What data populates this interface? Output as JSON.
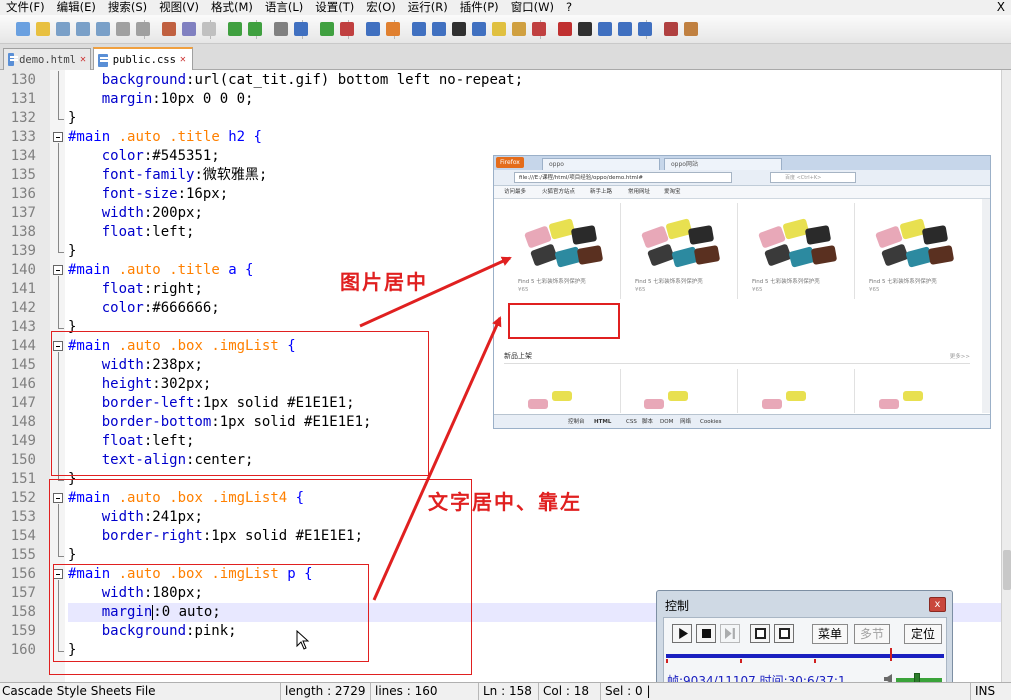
{
  "menubar": {
    "items": [
      "文件(F)",
      "编辑(E)",
      "搜索(S)",
      "视图(V)",
      "格式(M)",
      "语言(L)",
      "设置(T)",
      "宏(O)",
      "运行(R)",
      "插件(P)",
      "窗口(W)",
      "?"
    ],
    "close": "X"
  },
  "tabs": [
    {
      "label": "demo.html"
    },
    {
      "label": "public.css"
    }
  ],
  "editor": {
    "lines": [
      {
        "n": "130",
        "parts": [
          [
            "    ",
            "val"
          ],
          [
            "background",
            "prop"
          ],
          [
            ":url(cat_tit.gif) bottom left no-repeat;",
            "val"
          ]
        ]
      },
      {
        "n": "131",
        "parts": [
          [
            "    ",
            "val"
          ],
          [
            "margin",
            "prop"
          ],
          [
            ":10px 0 0 0;",
            "val"
          ]
        ]
      },
      {
        "n": "132",
        "parts": [
          [
            "}",
            "val"
          ]
        ]
      },
      {
        "n": "133",
        "parts": [
          [
            "#main",
            "id"
          ],
          [
            " ",
            "val"
          ],
          [
            ".auto",
            "cls"
          ],
          [
            " ",
            "val"
          ],
          [
            ".title",
            "cls"
          ],
          [
            " h2 {",
            "sel"
          ]
        ]
      },
      {
        "n": "134",
        "parts": [
          [
            "    ",
            "val"
          ],
          [
            "color",
            "prop"
          ],
          [
            ":#545351;",
            "val"
          ]
        ]
      },
      {
        "n": "135",
        "parts": [
          [
            "    ",
            "val"
          ],
          [
            "font-family",
            "prop"
          ],
          [
            ":微软雅黑;",
            "val"
          ]
        ]
      },
      {
        "n": "136",
        "parts": [
          [
            "    ",
            "val"
          ],
          [
            "font-size",
            "prop"
          ],
          [
            ":16px;",
            "val"
          ]
        ]
      },
      {
        "n": "137",
        "parts": [
          [
            "    ",
            "val"
          ],
          [
            "width",
            "prop"
          ],
          [
            ":200px;",
            "val"
          ]
        ]
      },
      {
        "n": "138",
        "parts": [
          [
            "    ",
            "val"
          ],
          [
            "float",
            "prop"
          ],
          [
            ":left;",
            "val"
          ]
        ]
      },
      {
        "n": "139",
        "parts": [
          [
            "}",
            "val"
          ]
        ]
      },
      {
        "n": "140",
        "parts": [
          [
            "#main",
            "id"
          ],
          [
            " ",
            "val"
          ],
          [
            ".auto",
            "cls"
          ],
          [
            " ",
            "val"
          ],
          [
            ".title",
            "cls"
          ],
          [
            " a {",
            "sel"
          ]
        ]
      },
      {
        "n": "141",
        "parts": [
          [
            "    ",
            "val"
          ],
          [
            "float",
            "prop"
          ],
          [
            ":right;",
            "val"
          ]
        ]
      },
      {
        "n": "142",
        "parts": [
          [
            "    ",
            "val"
          ],
          [
            "color",
            "prop"
          ],
          [
            ":#666666;",
            "val"
          ]
        ]
      },
      {
        "n": "143",
        "parts": [
          [
            "}",
            "val"
          ]
        ]
      },
      {
        "n": "144",
        "parts": [
          [
            "#main",
            "id"
          ],
          [
            " ",
            "val"
          ],
          [
            ".auto",
            "cls"
          ],
          [
            " ",
            "val"
          ],
          [
            ".box",
            "cls"
          ],
          [
            " ",
            "val"
          ],
          [
            ".imgList",
            "cls"
          ],
          [
            " {",
            "sel"
          ]
        ]
      },
      {
        "n": "145",
        "parts": [
          [
            "    ",
            "val"
          ],
          [
            "width",
            "prop"
          ],
          [
            ":238px;",
            "val"
          ]
        ]
      },
      {
        "n": "146",
        "parts": [
          [
            "    ",
            "val"
          ],
          [
            "height",
            "prop"
          ],
          [
            ":302px;",
            "val"
          ]
        ]
      },
      {
        "n": "147",
        "parts": [
          [
            "    ",
            "val"
          ],
          [
            "border-left",
            "prop"
          ],
          [
            ":1px solid #E1E1E1;",
            "val"
          ]
        ]
      },
      {
        "n": "148",
        "parts": [
          [
            "    ",
            "val"
          ],
          [
            "border-bottom",
            "prop"
          ],
          [
            ":1px solid #E1E1E1;",
            "val"
          ]
        ]
      },
      {
        "n": "149",
        "parts": [
          [
            "    ",
            "val"
          ],
          [
            "float",
            "prop"
          ],
          [
            ":left;",
            "val"
          ]
        ]
      },
      {
        "n": "150",
        "parts": [
          [
            "    ",
            "val"
          ],
          [
            "text-align",
            "prop"
          ],
          [
            ":center;",
            "val"
          ]
        ]
      },
      {
        "n": "151",
        "parts": [
          [
            "}",
            "val"
          ]
        ]
      },
      {
        "n": "152",
        "parts": [
          [
            "#main",
            "id"
          ],
          [
            " ",
            "val"
          ],
          [
            ".auto",
            "cls"
          ],
          [
            " ",
            "val"
          ],
          [
            ".box",
            "cls"
          ],
          [
            " ",
            "val"
          ],
          [
            ".imgList4",
            "cls"
          ],
          [
            " {",
            "sel"
          ]
        ]
      },
      {
        "n": "153",
        "parts": [
          [
            "    ",
            "val"
          ],
          [
            "width",
            "prop"
          ],
          [
            ":241px;",
            "val"
          ]
        ]
      },
      {
        "n": "154",
        "parts": [
          [
            "    ",
            "val"
          ],
          [
            "border-right",
            "prop"
          ],
          [
            ":1px solid #E1E1E1;",
            "val"
          ]
        ]
      },
      {
        "n": "155",
        "parts": [
          [
            "}",
            "val"
          ]
        ]
      },
      {
        "n": "156",
        "parts": [
          [
            "#main",
            "id"
          ],
          [
            " ",
            "val"
          ],
          [
            ".auto",
            "cls"
          ],
          [
            " ",
            "val"
          ],
          [
            ".box",
            "cls"
          ],
          [
            " ",
            "val"
          ],
          [
            ".imgList",
            "cls"
          ],
          [
            " p {",
            "sel"
          ]
        ]
      },
      {
        "n": "157",
        "parts": [
          [
            "    ",
            "val"
          ],
          [
            "width",
            "prop"
          ],
          [
            ":180px;",
            "val"
          ]
        ]
      },
      {
        "n": "158",
        "parts": [
          [
            "    ",
            "val"
          ],
          [
            "margin",
            "prop"
          ],
          [
            ":0 auto;",
            "val"
          ]
        ]
      },
      {
        "n": "159",
        "parts": [
          [
            "    ",
            "val"
          ],
          [
            "background",
            "prop"
          ],
          [
            ":pink;",
            "val"
          ]
        ]
      },
      {
        "n": "160",
        "parts": [
          [
            "}",
            "val"
          ]
        ]
      }
    ]
  },
  "annotations": {
    "label_center": "图片居中",
    "label_text": "文字居中、靠左"
  },
  "browser": {
    "ff_button": "Firefox",
    "tabs": [
      "oppo",
      "oppo网站"
    ],
    "url": "file:///E:/课程/html/项目经验/oppo/demo.html#",
    "search_placeholder": "百度 <Ctrl+K>",
    "bookmarks": [
      "访问最多",
      "火狐官方站点",
      "新手上路",
      "常用网址",
      "爱淘宝"
    ],
    "product_name": "Find 5 七彩装饰系列保护壳",
    "product_price": "¥65",
    "section_title": "新品上架",
    "more": "更多>>",
    "firebug": [
      "控制台",
      "HTML",
      "CSS",
      "脚本",
      "DOM",
      "网络",
      "Cookies"
    ]
  },
  "control": {
    "title": "控制",
    "close": "x",
    "btn_menu": "菜单",
    "btn_section": "多节",
    "btn_locate": "定位",
    "info": "帧:9034/11107 时间:30:6/37:1"
  },
  "statusbar": {
    "type": "Cascade Style Sheets File",
    "length": "length : 2729",
    "lines": "lines : 160",
    "ln": "Ln : 158",
    "col": "Col : 18",
    "sel": "Sel : 0 |",
    "mode": "INS"
  },
  "colors": {
    "annotation_red": "#e02020",
    "selector_blue": "#0000ff",
    "class_orange": "#ff8000",
    "property_blue": "#0000cc"
  }
}
